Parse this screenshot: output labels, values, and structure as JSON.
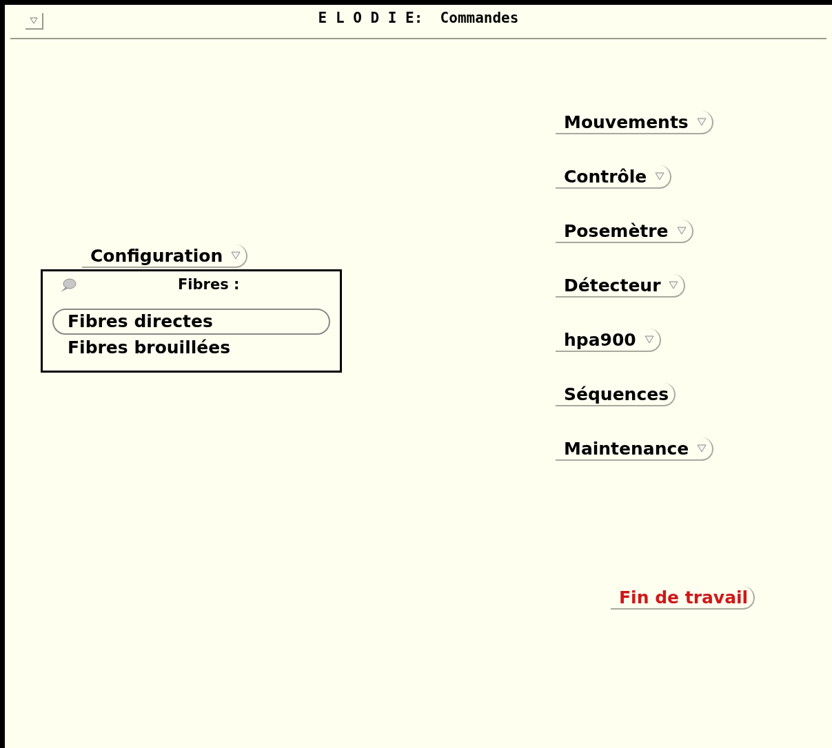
{
  "window": {
    "title": "E L O D I E:  Commandes"
  },
  "configuration": {
    "button": {
      "label": "Configuration",
      "has_menu": true
    },
    "panel": {
      "title": "Fibres :",
      "items": [
        {
          "label": "Fibres directes",
          "selected": true
        },
        {
          "label": "Fibres brouillées",
          "selected": false
        }
      ]
    }
  },
  "menu_buttons": [
    {
      "label": "Mouvements",
      "has_menu": true
    },
    {
      "label": "Contrôle",
      "has_menu": true
    },
    {
      "label": "Posemètre",
      "has_menu": true
    },
    {
      "label": "Détecteur",
      "has_menu": true
    },
    {
      "label": "hpa900",
      "has_menu": true
    },
    {
      "label": "Séquences",
      "has_menu": false
    },
    {
      "label": "Maintenance",
      "has_menu": true
    }
  ],
  "exit_button": {
    "label": "Fin de travail"
  }
}
